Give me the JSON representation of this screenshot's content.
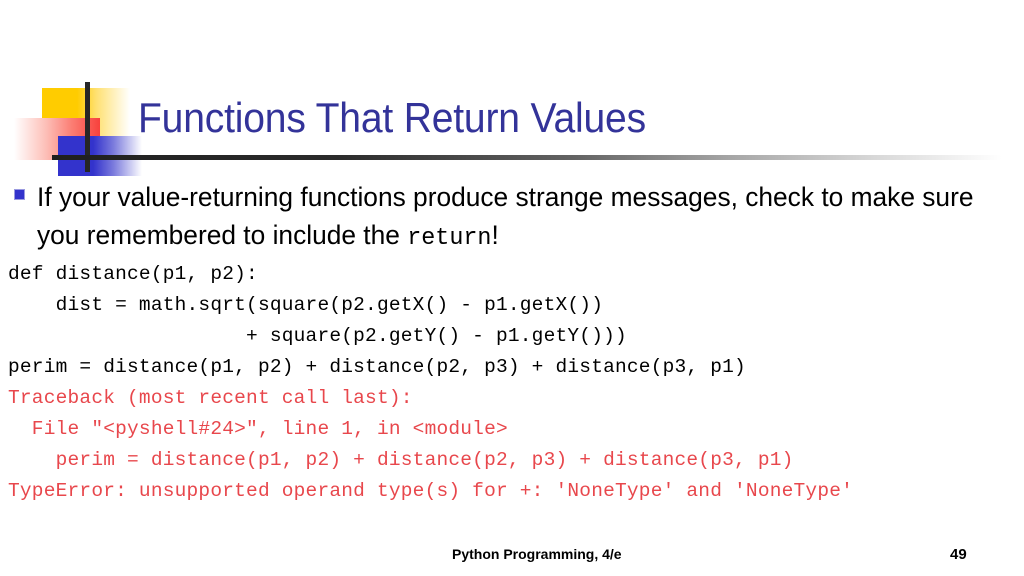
{
  "slide": {
    "title": "Functions That Return Values",
    "title_color": "#333399",
    "background": "#ffffff"
  },
  "logo": {
    "yellow_color": "#ffcc00",
    "red_color": "#f8413c",
    "blue_color": "#3333cc",
    "line_color": "#262626"
  },
  "bullet": {
    "marker_color": "#3333cc",
    "text_part1": "If your value-returning functions produce strange messages, check to make sure you remembered to include the ",
    "code_word": "return",
    "text_part2": "!"
  },
  "code": {
    "text_color": "#000000",
    "error_color": "#e8474c",
    "lines": [
      {
        "text": "def distance(p1, p2):",
        "error": false
      },
      {
        "text": "    dist = math.sqrt(square(p2.getX() - p1.getX())",
        "error": false
      },
      {
        "text": "                    + square(p2.getY() - p1.getY()))",
        "error": false
      },
      {
        "text": "perim = distance(p1, p2) + distance(p2, p3) + distance(p3, p1)",
        "error": false
      },
      {
        "text": "Traceback (most recent call last):",
        "error": true
      },
      {
        "text": "  File \"<pyshell#24>\", line 1, in <module>",
        "error": true
      },
      {
        "text": "    perim = distance(p1, p2) + distance(p2, p3) + distance(p3, p1)",
        "error": true
      },
      {
        "text": "TypeError: unsupported operand type(s) for +: 'NoneType' and 'NoneType'",
        "error": true
      }
    ]
  },
  "footer": {
    "book_title": "Python Programming, 4/e",
    "page_number": "49"
  }
}
